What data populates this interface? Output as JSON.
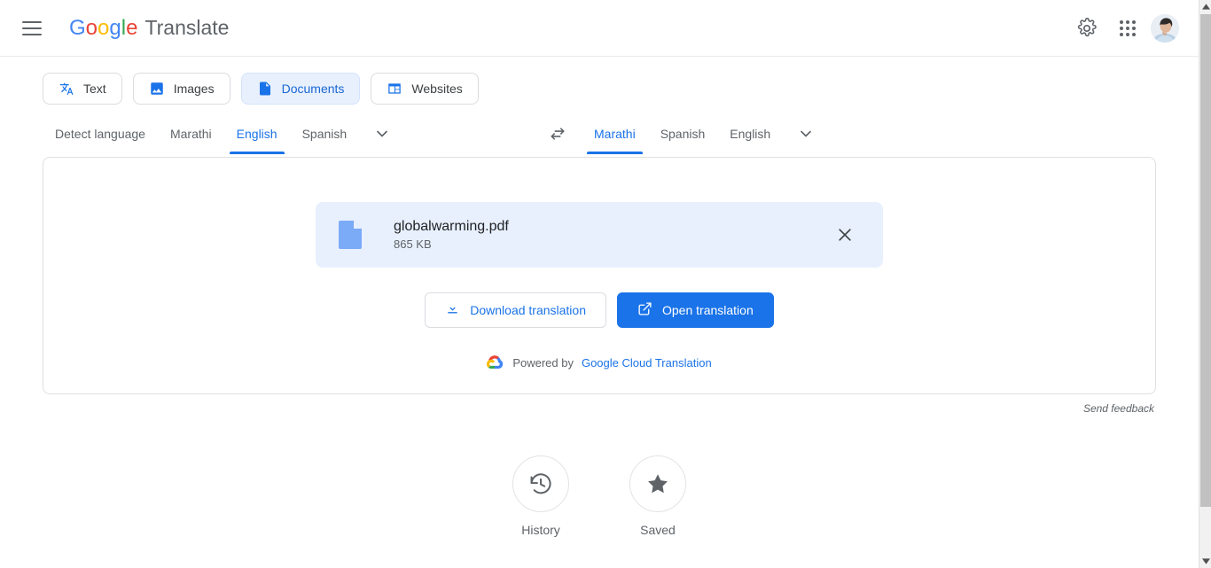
{
  "header": {
    "menu_icon": "hamburger-menu-icon",
    "logo_letters": [
      "G",
      "o",
      "o",
      "g",
      "l",
      "e"
    ],
    "product_name": "Translate",
    "settings_icon": "gear-icon",
    "apps_icon": "apps-grid-icon",
    "avatar_label": "account-avatar"
  },
  "tabs": [
    {
      "label": "Text",
      "icon": "translate-icon",
      "active": false
    },
    {
      "label": "Images",
      "icon": "image-icon",
      "active": false
    },
    {
      "label": "Documents",
      "icon": "document-icon",
      "active": true
    },
    {
      "label": "Websites",
      "icon": "website-icon",
      "active": false
    }
  ],
  "source_languages": {
    "items": [
      "Detect language",
      "Marathi",
      "English",
      "Spanish"
    ],
    "selected": "English",
    "more_icon": "chevron-down-icon"
  },
  "swap": {
    "icon": "swap-horizontal-icon"
  },
  "target_languages": {
    "items": [
      "Marathi",
      "Spanish",
      "English"
    ],
    "selected": "Marathi",
    "more_icon": "chevron-down-icon"
  },
  "file": {
    "icon": "pdf-file-icon",
    "name": "globalwarming.pdf",
    "size": "865 KB",
    "remove_icon": "close-icon"
  },
  "actions": {
    "download_label": "Download translation",
    "download_icon": "download-icon",
    "open_label": "Open translation",
    "open_icon": "open-in-new-icon"
  },
  "powered": {
    "prefix": "Powered by",
    "link": "Google Cloud Translation",
    "icon": "google-cloud-icon"
  },
  "feedback": {
    "label": "Send feedback"
  },
  "shortcuts": [
    {
      "label": "History",
      "icon": "history-clock-icon"
    },
    {
      "label": "Saved",
      "icon": "star-filled-icon"
    }
  ],
  "colors": {
    "accent": "#1a73e8",
    "chip_bg": "#e8f0fe",
    "text_primary": "#202124",
    "text_secondary": "#5f6368"
  }
}
